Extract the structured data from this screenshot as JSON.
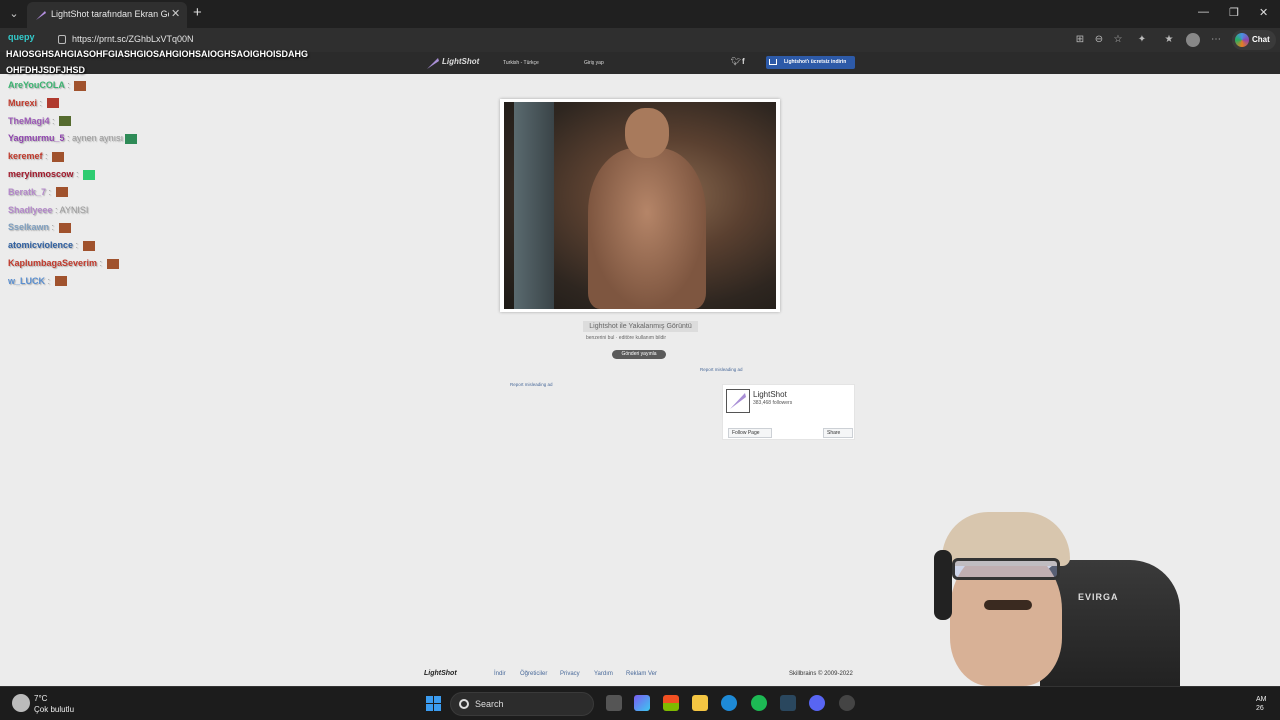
{
  "browser": {
    "tab_title": "LightShot tarafından Ekran Görüntüsü",
    "url": "https://prnt.sc/ZGhbLxVTq00N",
    "chat_label": "Chat"
  },
  "site": {
    "logo": "LightShot",
    "language": "Turkish - Türkçe",
    "login": "Giriş yap",
    "download_label": "Lightshot'ı ücretsiz indirin",
    "caption_title": "Lightshot ile Yakalanmış Görüntü",
    "caption_sub": "benzerini bul · editöre kullanım bildir",
    "share_label": "Gönderi yayınla",
    "report_ad_1": "Report misleading ad",
    "report_ad_2": "Report misleading ad",
    "fb_name": "LightShot",
    "fb_followers": "383,468 followers",
    "fb_follow": "Follow Page",
    "fb_share": "Share",
    "footer": {
      "logo": "LightShot",
      "links": [
        "İndir",
        "Öğreticiler",
        "Privacy",
        "Yardım",
        "Reklam Ver"
      ],
      "copyright": "Skillbrains © 2009-2022"
    }
  },
  "chat": {
    "top_user": "quepy",
    "top_message_1": "HAIOSGHSAHGIASOHFGIASHGIOSAHGIOHSAIOGHSAOIGHOISDAHG",
    "top_message_2": "OHFDHJSDFJHSD",
    "separator": ":",
    "lines": [
      {
        "user": "AreYouCOLA",
        "color": "#3cb371",
        "text": ""
      },
      {
        "user": "Murexi",
        "color": "#c0392b",
        "text": ""
      },
      {
        "user": "TheMagi4",
        "color": "#9b59b6",
        "text": ""
      },
      {
        "user": "Yagmurmu_5",
        "color": "#8e44ad",
        "text": "aynen aynısı"
      },
      {
        "user": "keremef",
        "color": "#c0392b",
        "text": ""
      },
      {
        "user": "meryinmoscow",
        "color": "#a0182a",
        "text": ""
      },
      {
        "user": "Beratk_7",
        "color": "#b388c9",
        "text": ""
      },
      {
        "user": "Shadlyeee",
        "color": "#b388c9",
        "text": "AYNISI"
      },
      {
        "user": "Sselkawn",
        "color": "#7f9fbf",
        "text": ""
      },
      {
        "user": "atomicviolence",
        "color": "#2e5fa0",
        "text": ""
      },
      {
        "user": "KaplumbagaSeverim",
        "color": "#c0392b",
        "text": ""
      },
      {
        "user": "w_LUCK",
        "color": "#5a8fd0",
        "text": ""
      }
    ]
  },
  "webcam": {
    "chair_brand": "EVIRGA"
  },
  "taskbar": {
    "temperature": "7°C",
    "weather": "Çok bulutlu",
    "search_label": "Search",
    "clock_top": "AM",
    "clock_bottom": "26"
  }
}
